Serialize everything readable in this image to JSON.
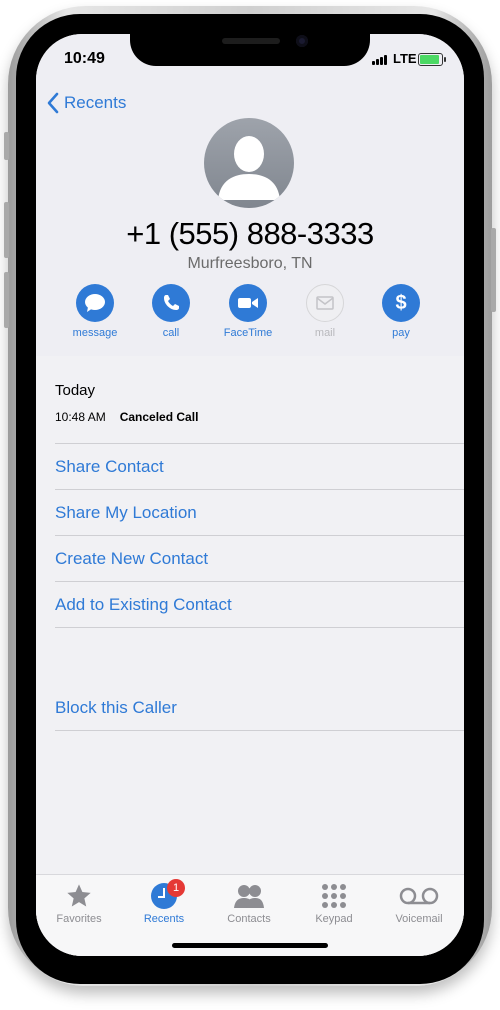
{
  "status": {
    "time": "10:49",
    "network": "LTE"
  },
  "nav": {
    "back_label": "Recents"
  },
  "contact": {
    "number": "+1 (555) 888-3333",
    "location": "Murfreesboro, TN"
  },
  "actions": [
    {
      "label": "message",
      "icon": "message-icon",
      "enabled": true
    },
    {
      "label": "call",
      "icon": "phone-icon",
      "enabled": true
    },
    {
      "label": "FaceTime",
      "icon": "video-icon",
      "enabled": true
    },
    {
      "label": "mail",
      "icon": "mail-icon",
      "enabled": false
    },
    {
      "label": "pay",
      "icon": "dollar-icon",
      "enabled": true
    }
  ],
  "history": {
    "day": "Today",
    "time": "10:48 AM",
    "type": "Canceled Call"
  },
  "options": [
    "Share Contact",
    "Share My Location",
    "Create New Contact",
    "Add to Existing Contact"
  ],
  "block_option": "Block this Caller",
  "tabs": [
    {
      "label": "Favorites",
      "icon": "star-icon",
      "active": false
    },
    {
      "label": "Recents",
      "icon": "clock-icon",
      "active": true,
      "badge": "1"
    },
    {
      "label": "Contacts",
      "icon": "contacts-icon",
      "active": false
    },
    {
      "label": "Keypad",
      "icon": "keypad-icon",
      "active": false
    },
    {
      "label": "Voicemail",
      "icon": "voicemail-icon",
      "active": false
    }
  ],
  "colors": {
    "accent": "#2f7ad6",
    "badge": "#e53935",
    "inactive": "#8d8d92"
  }
}
